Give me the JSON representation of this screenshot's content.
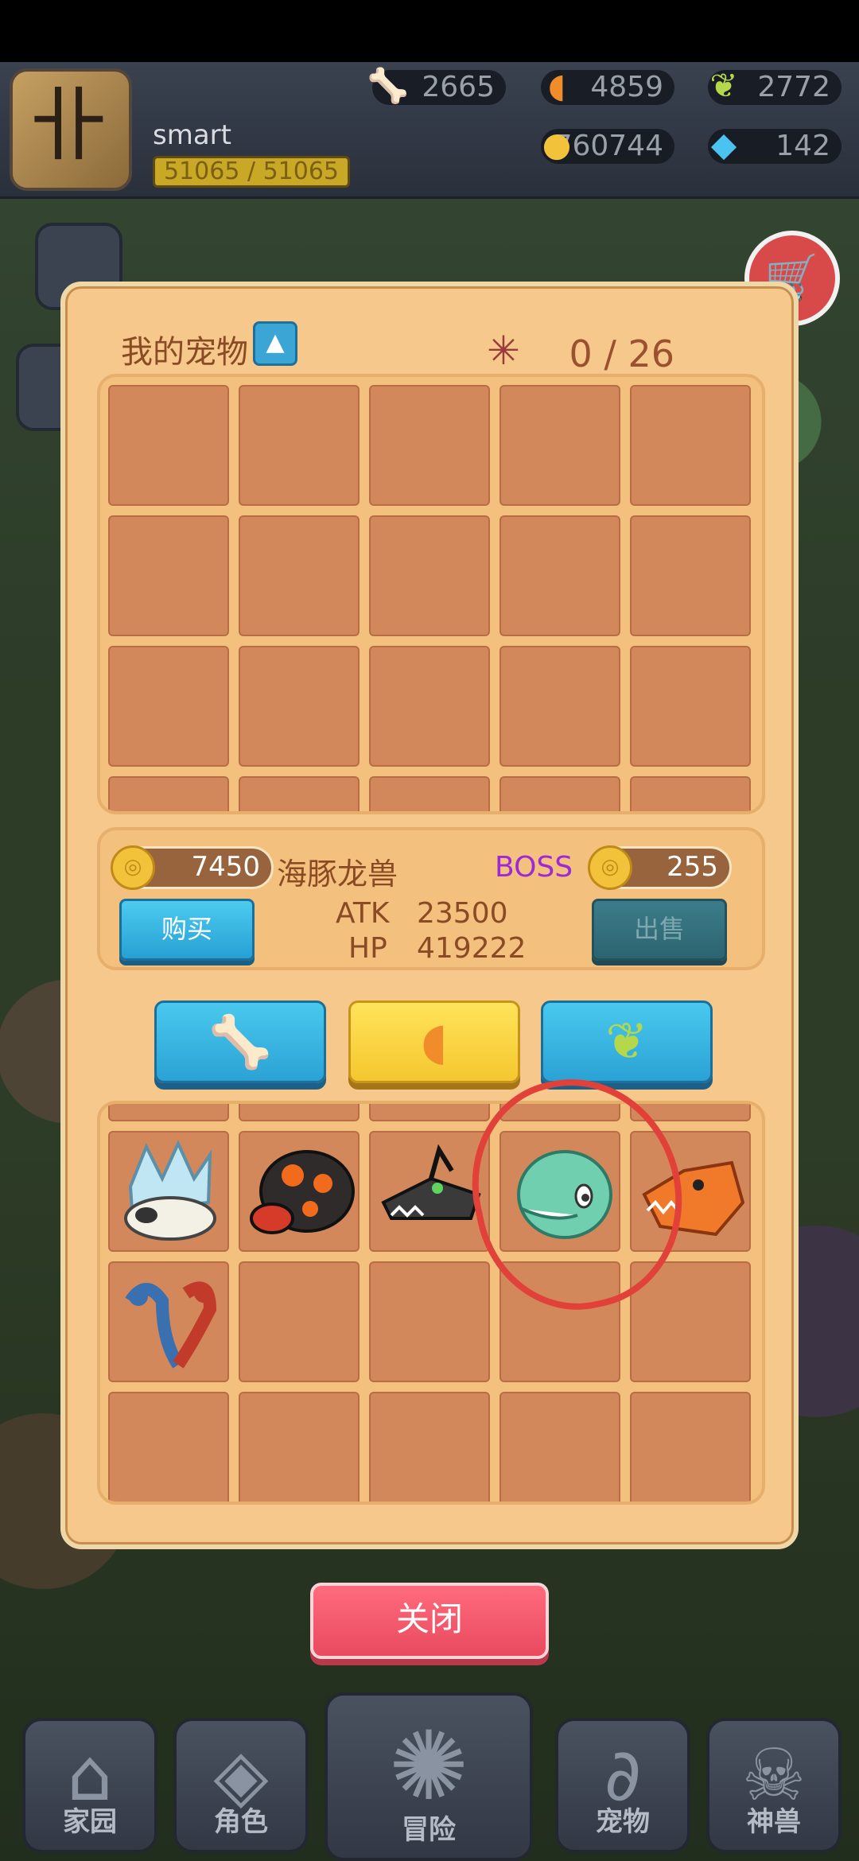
{
  "hud": {
    "username": "smart",
    "hp": "51065 / 51065",
    "bone": "2665",
    "claw": "4859",
    "leaf": "2772",
    "gold": "760744",
    "gem": "142"
  },
  "panel": {
    "title": "我的宠物",
    "toggle_icon": "▲",
    "capacity": "0 / 26"
  },
  "selected_pet": {
    "buy_price": "7450",
    "name": "海豚龙兽",
    "boss_label": "BOSS",
    "sell_price": "255",
    "buy_label": "购买",
    "sell_label": "出售",
    "atk_label": "ATK",
    "atk_value": "23500",
    "hp_label": "HP",
    "hp_value": "419222"
  },
  "tabs": [
    {
      "icon": "bone-icon",
      "active": false
    },
    {
      "icon": "claw-icon",
      "active": true
    },
    {
      "icon": "leaf-icon",
      "active": false
    }
  ],
  "close_label": "关闭",
  "nav": [
    {
      "label": "家园",
      "icon": "home-icon"
    },
    {
      "label": "角色",
      "icon": "mask-icon"
    },
    {
      "label": "冒险",
      "icon": "paw-icon"
    },
    {
      "label": "宠物",
      "icon": "pet-icon"
    },
    {
      "label": "神兽",
      "icon": "dino-skull-icon"
    }
  ],
  "colors": {
    "panel": "#f6c88b",
    "cell": "#d2885b",
    "accent_blue": "#2ba2d5",
    "accent_yellow": "#f5c72f",
    "boss_purple": "#9c2bd6",
    "close_red": "#e94a5e"
  }
}
